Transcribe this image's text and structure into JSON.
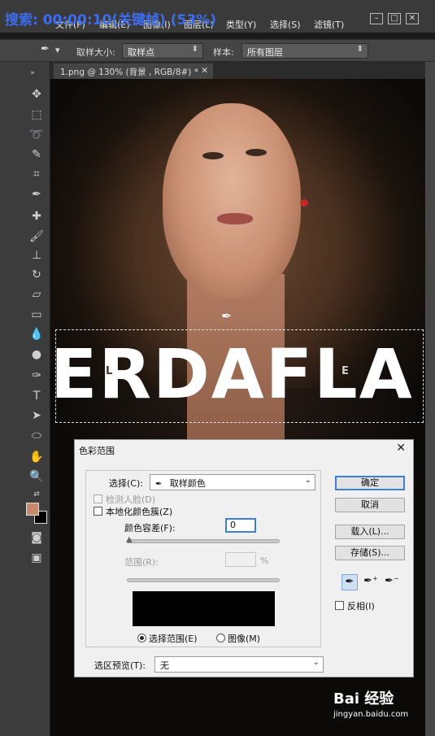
{
  "overlay": {
    "title": "搜索:  00:00:10(关键帧) (53%)"
  },
  "menubar": {
    "items": [
      "文件(F)",
      "编辑(E)",
      "图像(I)",
      "图层(L)",
      "类型(Y)",
      "选择(S)",
      "滤镜(T)"
    ]
  },
  "optbar": {
    "sample_size_label": "取样大小:",
    "sample_size_value": "取样点",
    "sample_label": "样本:",
    "sample_value": "所有图层"
  },
  "document": {
    "tab_title": "1.png @ 130% (背景 , RGB/8#) *",
    "big_text": "ERDAFLA",
    "small_text_left": "L",
    "small_text_right": "E"
  },
  "dialog": {
    "title": "色彩范围",
    "select_label": "选择(C):",
    "select_value": "取样颜色",
    "detect_faces_label": "检测人脸(D)",
    "localized_label": "本地化颜色簇(Z)",
    "fuzziness_label": "颜色容差(F):",
    "fuzziness_value": "0",
    "range_label": "范围(R):",
    "range_unit": "%",
    "radio_selection": "选择范围(E)",
    "radio_image": "图像(M)",
    "preview_label": "选区预览(T):",
    "preview_value": "无",
    "ok_label": "确定",
    "cancel_label": "取消",
    "load_label": "载入(L)...",
    "save_label": "存储(S)...",
    "invert_label": "反相(I)"
  },
  "watermark": {
    "brand": "Bai 经验",
    "url": "jingyan.baidu.com"
  },
  "colors": {
    "foreground": "#c98a6e",
    "background": "#000000",
    "accent": "#3c7fd6"
  }
}
